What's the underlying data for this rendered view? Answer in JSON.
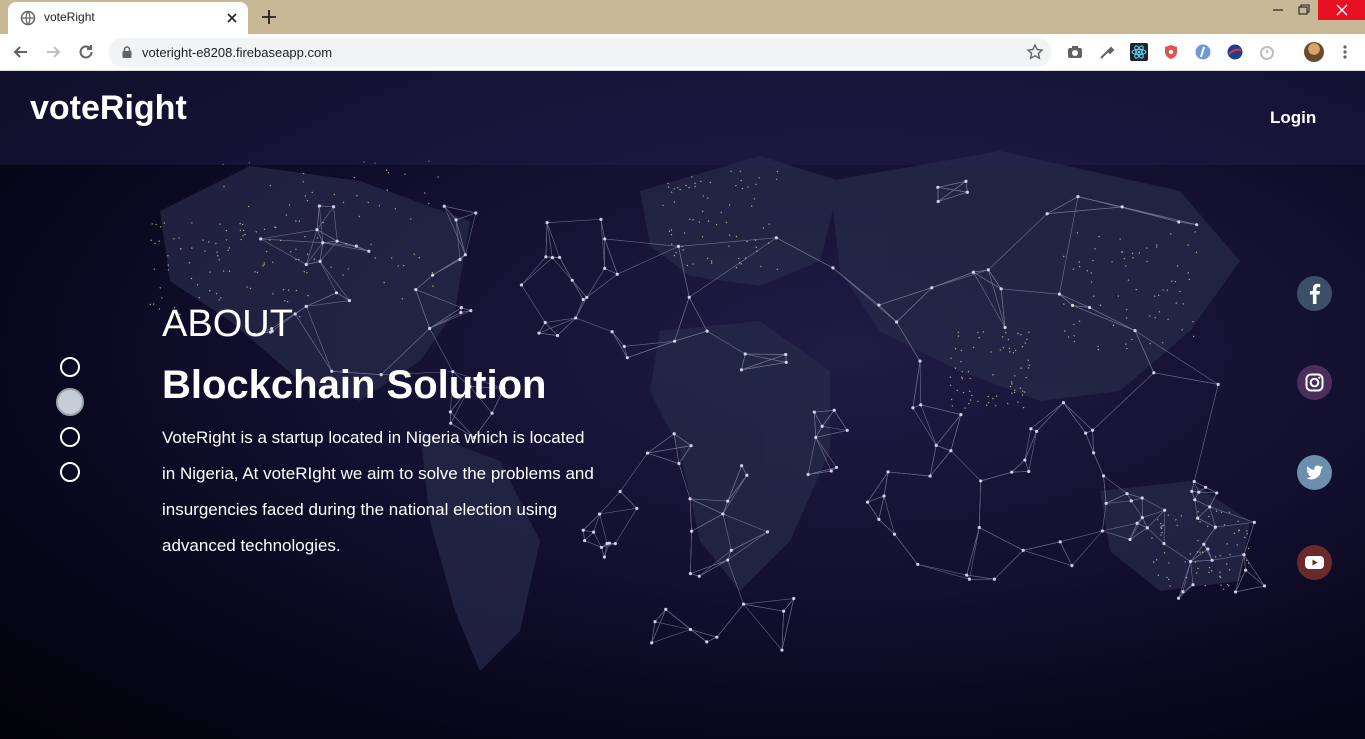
{
  "browser": {
    "tab_title": "voteRight",
    "url": "voteright-e8208.firebaseapp.com"
  },
  "site": {
    "logo": "voteRight",
    "login_label": "Login"
  },
  "hero": {
    "eyebrow": "ABOUT",
    "headline": "Blockchain Solution",
    "description": "VoteRight is a startup located in Nigeria which is located in Nigeria, At voteRIght we aim to solve the problems and insurgencies faced during the national election using advanced technologies.",
    "slide_count": 4,
    "active_slide": 2
  },
  "social": [
    {
      "name": "facebook",
      "color": "#3b4f6b"
    },
    {
      "name": "instagram",
      "color": "#4a2f5e"
    },
    {
      "name": "twitter",
      "color": "#6c8fae"
    },
    {
      "name": "youtube",
      "color": "#6b2a2a"
    }
  ]
}
